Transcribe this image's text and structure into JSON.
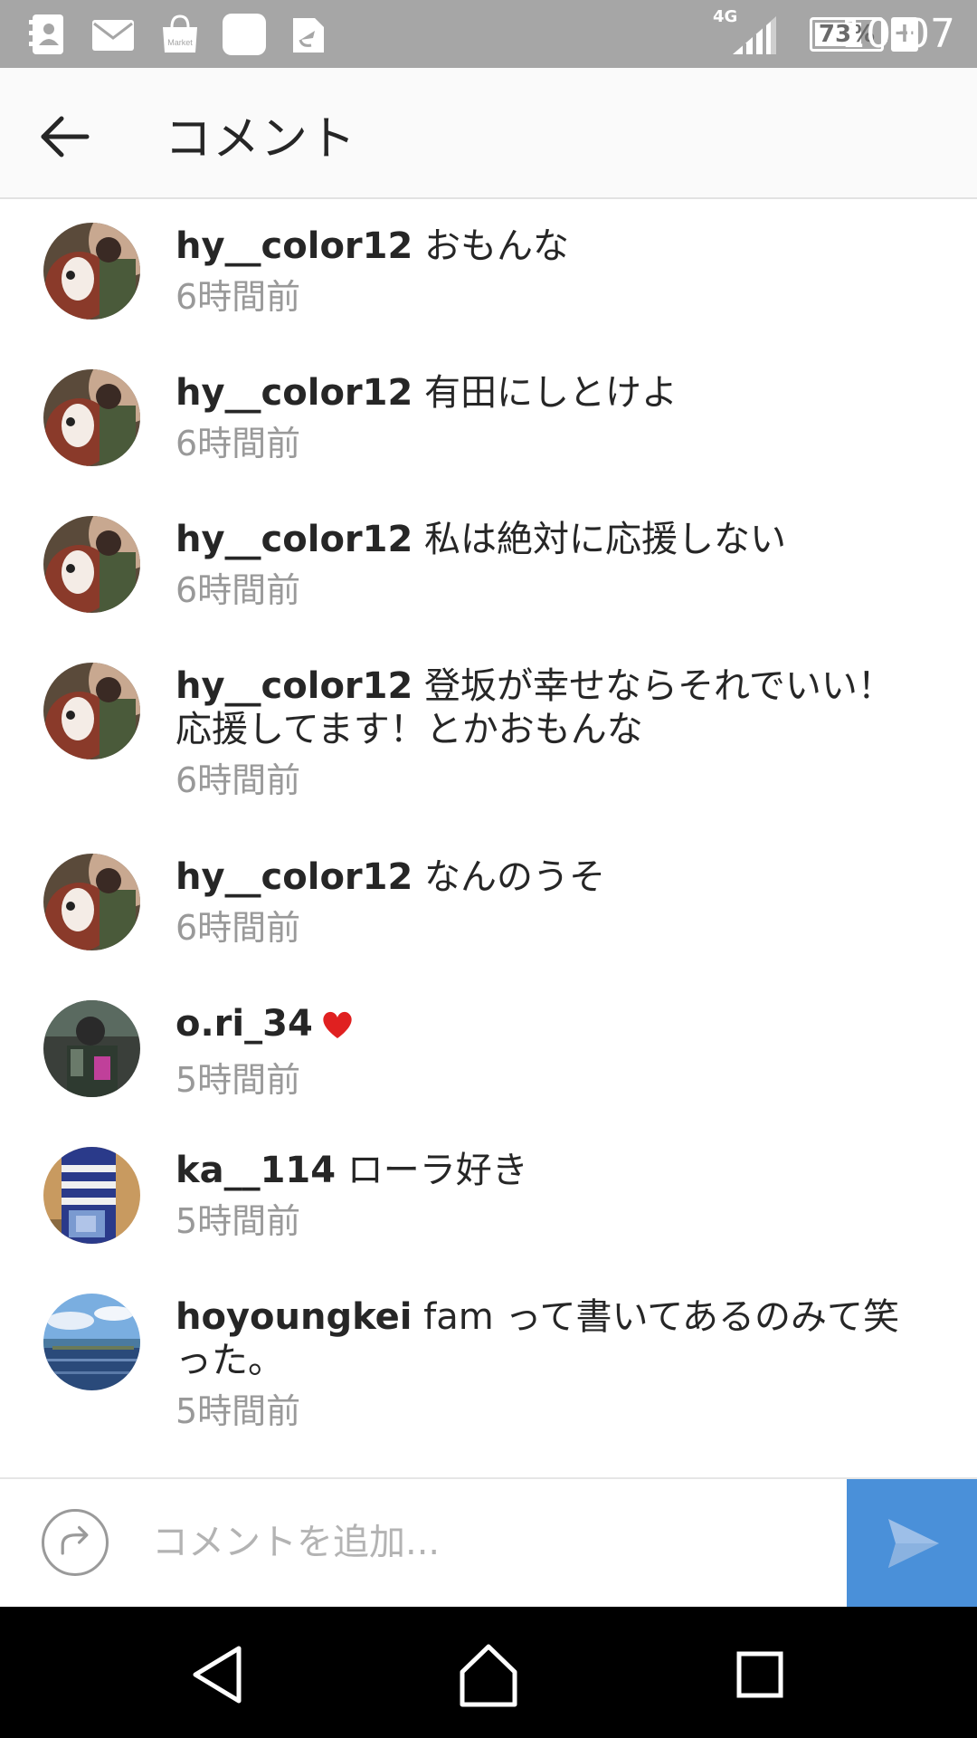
{
  "status_bar": {
    "network": "4G",
    "battery": "73%",
    "battery_level": 0.73,
    "charging_symbol": "+",
    "time": "10:07",
    "notification_icons": [
      "contacts-icon",
      "mail-icon",
      "market-icon",
      "blank-app-icon",
      "file-transfer-icon"
    ],
    "market_label": "Market"
  },
  "header": {
    "title": "コメント",
    "back_icon": "back-arrow-icon"
  },
  "comments": [
    {
      "user": "hy__color12",
      "text": " おもんな",
      "time": "6時間前",
      "avatar": "avatar-teddy-bear"
    },
    {
      "user": "hy__color12",
      "text": " 有田にしとけよ",
      "time": "6時間前",
      "avatar": "avatar-teddy-bear"
    },
    {
      "user": "hy__color12",
      "text": " 私は絶対に応援しない",
      "time": "6時間前",
      "avatar": "avatar-teddy-bear"
    },
    {
      "user": "hy__color12",
      "text": " 登坂が幸せならそれでいい！応援してます！とかおもんな",
      "time": "6時間前",
      "avatar": "avatar-teddy-bear"
    },
    {
      "user": "hy__color12",
      "text": " なんのうそ",
      "time": "6時間前",
      "avatar": "avatar-teddy-bear"
    },
    {
      "user": "o.ri_34",
      "text": "",
      "emoji": "heart-icon",
      "time": "5時間前",
      "avatar": "avatar-person-dark"
    },
    {
      "user": "ka__114",
      "text": " ローラ好き",
      "time": "5時間前",
      "avatar": "avatar-striped"
    },
    {
      "user": "hoyoungkei",
      "text": " fam って書いてあるのみて笑った。",
      "time": "5時間前",
      "avatar": "avatar-seascape"
    }
  ],
  "input": {
    "placeholder": "コメントを追加...",
    "value": "",
    "share_icon": "share-arrow-icon",
    "send_icon": "send-icon"
  },
  "colors": {
    "status_bar": "#a6a6a6",
    "header_bg": "#fafafa",
    "text_primary": "#262626",
    "text_secondary": "#999999",
    "send_button": "#4a90d9",
    "heart": "#e02020",
    "nav_bar": "#000000"
  },
  "nav": [
    "nav-back-icon",
    "nav-home-icon",
    "nav-recents-icon"
  ]
}
